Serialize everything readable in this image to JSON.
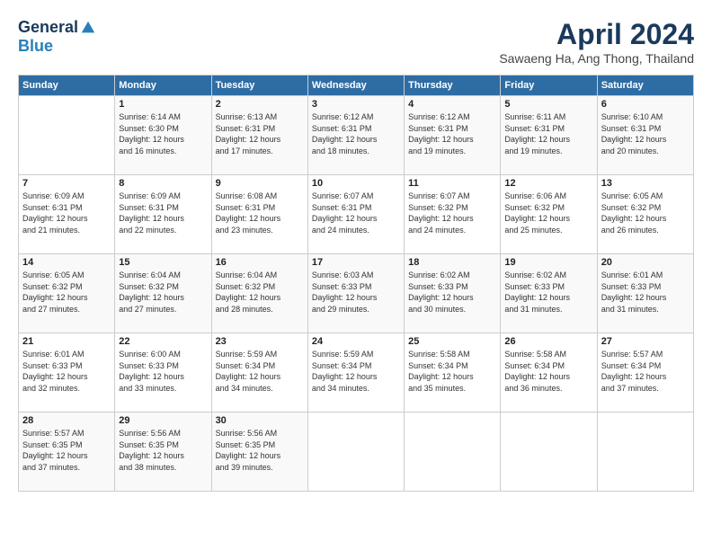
{
  "logo": {
    "general": "General",
    "blue": "Blue"
  },
  "title": {
    "month": "April 2024",
    "location": "Sawaeng Ha, Ang Thong, Thailand"
  },
  "days_header": [
    "Sunday",
    "Monday",
    "Tuesday",
    "Wednesday",
    "Thursday",
    "Friday",
    "Saturday"
  ],
  "weeks": [
    [
      {
        "day": "",
        "info": ""
      },
      {
        "day": "1",
        "info": "Sunrise: 6:14 AM\nSunset: 6:30 PM\nDaylight: 12 hours\nand 16 minutes."
      },
      {
        "day": "2",
        "info": "Sunrise: 6:13 AM\nSunset: 6:31 PM\nDaylight: 12 hours\nand 17 minutes."
      },
      {
        "day": "3",
        "info": "Sunrise: 6:12 AM\nSunset: 6:31 PM\nDaylight: 12 hours\nand 18 minutes."
      },
      {
        "day": "4",
        "info": "Sunrise: 6:12 AM\nSunset: 6:31 PM\nDaylight: 12 hours\nand 19 minutes."
      },
      {
        "day": "5",
        "info": "Sunrise: 6:11 AM\nSunset: 6:31 PM\nDaylight: 12 hours\nand 19 minutes."
      },
      {
        "day": "6",
        "info": "Sunrise: 6:10 AM\nSunset: 6:31 PM\nDaylight: 12 hours\nand 20 minutes."
      }
    ],
    [
      {
        "day": "7",
        "info": "Sunrise: 6:09 AM\nSunset: 6:31 PM\nDaylight: 12 hours\nand 21 minutes."
      },
      {
        "day": "8",
        "info": "Sunrise: 6:09 AM\nSunset: 6:31 PM\nDaylight: 12 hours\nand 22 minutes."
      },
      {
        "day": "9",
        "info": "Sunrise: 6:08 AM\nSunset: 6:31 PM\nDaylight: 12 hours\nand 23 minutes."
      },
      {
        "day": "10",
        "info": "Sunrise: 6:07 AM\nSunset: 6:31 PM\nDaylight: 12 hours\nand 24 minutes."
      },
      {
        "day": "11",
        "info": "Sunrise: 6:07 AM\nSunset: 6:32 PM\nDaylight: 12 hours\nand 24 minutes."
      },
      {
        "day": "12",
        "info": "Sunrise: 6:06 AM\nSunset: 6:32 PM\nDaylight: 12 hours\nand 25 minutes."
      },
      {
        "day": "13",
        "info": "Sunrise: 6:05 AM\nSunset: 6:32 PM\nDaylight: 12 hours\nand 26 minutes."
      }
    ],
    [
      {
        "day": "14",
        "info": "Sunrise: 6:05 AM\nSunset: 6:32 PM\nDaylight: 12 hours\nand 27 minutes."
      },
      {
        "day": "15",
        "info": "Sunrise: 6:04 AM\nSunset: 6:32 PM\nDaylight: 12 hours\nand 27 minutes."
      },
      {
        "day": "16",
        "info": "Sunrise: 6:04 AM\nSunset: 6:32 PM\nDaylight: 12 hours\nand 28 minutes."
      },
      {
        "day": "17",
        "info": "Sunrise: 6:03 AM\nSunset: 6:33 PM\nDaylight: 12 hours\nand 29 minutes."
      },
      {
        "day": "18",
        "info": "Sunrise: 6:02 AM\nSunset: 6:33 PM\nDaylight: 12 hours\nand 30 minutes."
      },
      {
        "day": "19",
        "info": "Sunrise: 6:02 AM\nSunset: 6:33 PM\nDaylight: 12 hours\nand 31 minutes."
      },
      {
        "day": "20",
        "info": "Sunrise: 6:01 AM\nSunset: 6:33 PM\nDaylight: 12 hours\nand 31 minutes."
      }
    ],
    [
      {
        "day": "21",
        "info": "Sunrise: 6:01 AM\nSunset: 6:33 PM\nDaylight: 12 hours\nand 32 minutes."
      },
      {
        "day": "22",
        "info": "Sunrise: 6:00 AM\nSunset: 6:33 PM\nDaylight: 12 hours\nand 33 minutes."
      },
      {
        "day": "23",
        "info": "Sunrise: 5:59 AM\nSunset: 6:34 PM\nDaylight: 12 hours\nand 34 minutes."
      },
      {
        "day": "24",
        "info": "Sunrise: 5:59 AM\nSunset: 6:34 PM\nDaylight: 12 hours\nand 34 minutes."
      },
      {
        "day": "25",
        "info": "Sunrise: 5:58 AM\nSunset: 6:34 PM\nDaylight: 12 hours\nand 35 minutes."
      },
      {
        "day": "26",
        "info": "Sunrise: 5:58 AM\nSunset: 6:34 PM\nDaylight: 12 hours\nand 36 minutes."
      },
      {
        "day": "27",
        "info": "Sunrise: 5:57 AM\nSunset: 6:34 PM\nDaylight: 12 hours\nand 37 minutes."
      }
    ],
    [
      {
        "day": "28",
        "info": "Sunrise: 5:57 AM\nSunset: 6:35 PM\nDaylight: 12 hours\nand 37 minutes."
      },
      {
        "day": "29",
        "info": "Sunrise: 5:56 AM\nSunset: 6:35 PM\nDaylight: 12 hours\nand 38 minutes."
      },
      {
        "day": "30",
        "info": "Sunrise: 5:56 AM\nSunset: 6:35 PM\nDaylight: 12 hours\nand 39 minutes."
      },
      {
        "day": "",
        "info": ""
      },
      {
        "day": "",
        "info": ""
      },
      {
        "day": "",
        "info": ""
      },
      {
        "day": "",
        "info": ""
      }
    ]
  ]
}
